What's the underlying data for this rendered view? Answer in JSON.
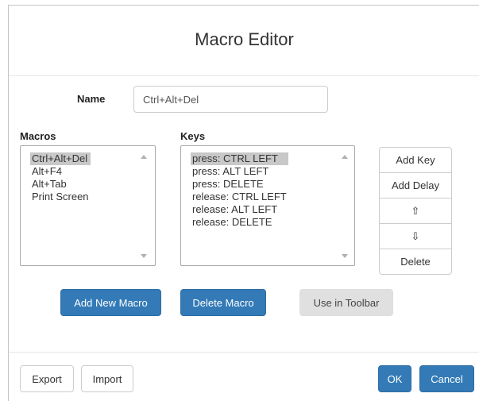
{
  "dialog": {
    "title": "Macro Editor",
    "name_label": "Name",
    "name_value": "Ctrl+Alt+Del"
  },
  "macros": {
    "label": "Macros",
    "items": [
      "Ctrl+Alt+Del",
      "Alt+F4",
      "Alt+Tab",
      "Print Screen"
    ],
    "selected_index": 0
  },
  "keys": {
    "label": "Keys",
    "items": [
      "press: CTRL LEFT",
      "press: ALT LEFT",
      "press: DELETE",
      "release: CTRL LEFT",
      "release: ALT LEFT",
      "release: DELETE"
    ],
    "selected_index": 0
  },
  "key_buttons": {
    "add_key": "Add Key",
    "add_delay": "Add Delay",
    "move_up": "⇧",
    "move_down": "⇩",
    "delete": "Delete"
  },
  "actions": {
    "add_new_macro": "Add New Macro",
    "delete_macro": "Delete Macro",
    "use_in_toolbar": "Use in Toolbar"
  },
  "footer": {
    "export": "Export",
    "import": "Import",
    "ok": "OK",
    "cancel": "Cancel"
  },
  "colors": {
    "primary": "#337ab7",
    "disabled": "#e0e0e0",
    "selection": "#c8c8c8"
  }
}
